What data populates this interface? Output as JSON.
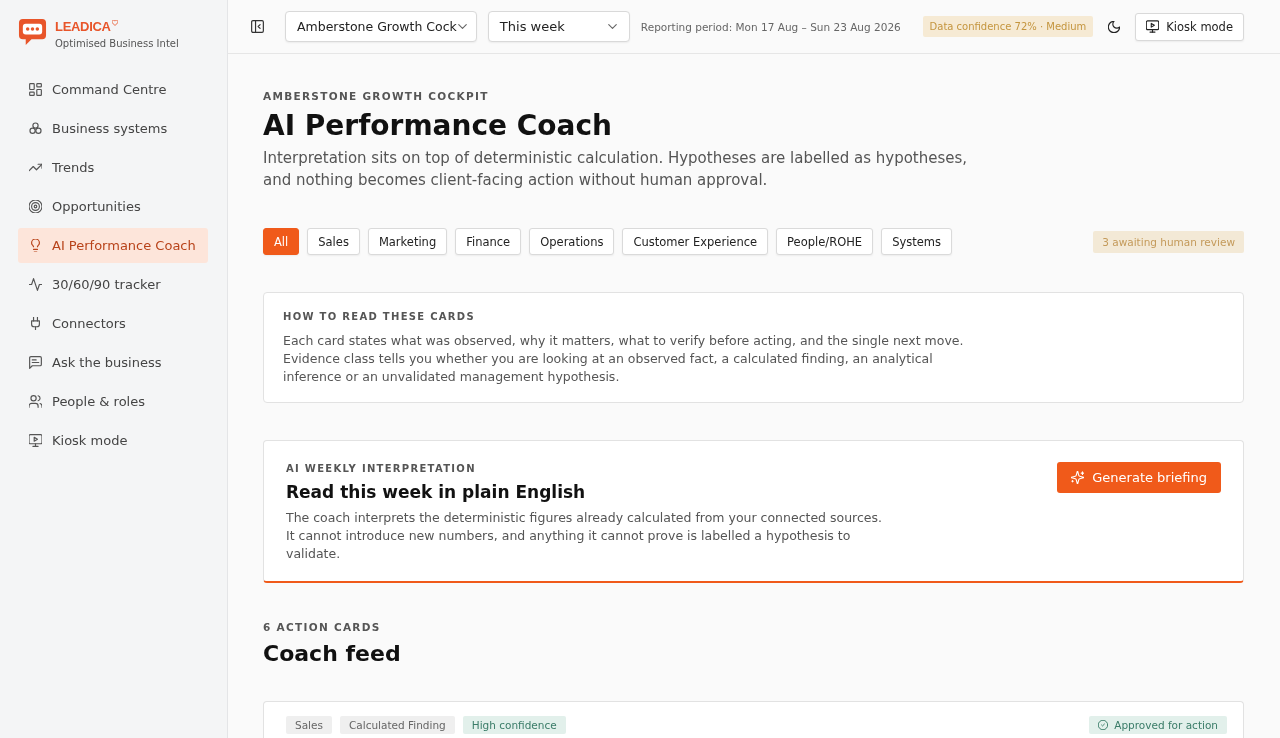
{
  "sidebar": {
    "brand": {
      "name": "LEADICA",
      "tagline": "Optimised Business Intel"
    },
    "items": [
      {
        "label": "Command Centre",
        "selected": false
      },
      {
        "label": "Business systems",
        "selected": false
      },
      {
        "label": "Trends",
        "selected": false
      },
      {
        "label": "Opportunities",
        "selected": false
      },
      {
        "label": "AI Performance Coach",
        "selected": true
      },
      {
        "label": "30/60/90 tracker",
        "selected": false
      },
      {
        "label": "Connectors",
        "selected": false
      },
      {
        "label": "Ask the business",
        "selected": false
      },
      {
        "label": "People & roles",
        "selected": false
      },
      {
        "label": "Kiosk mode",
        "selected": false
      }
    ]
  },
  "topbar": {
    "workspace": {
      "value": "Amberstone Growth Cock"
    },
    "period": {
      "value": "This week"
    },
    "reporting_period": "Reporting period: Mon 17 Aug – Sun 23 Aug 2026",
    "confidence_badge": "Data confidence 72% · Medium",
    "kiosk_button": "Kiosk mode"
  },
  "header": {
    "eyebrow": "AMBERSTONE GROWTH COCKPIT",
    "title": "AI Performance Coach",
    "description": "Interpretation sits on top of deterministic calculation. Hypotheses are labelled as hypotheses, and nothing becomes client-facing action without human approval."
  },
  "filters": {
    "chips": [
      {
        "label": "All",
        "selected": true
      },
      {
        "label": "Sales",
        "selected": false
      },
      {
        "label": "Marketing",
        "selected": false
      },
      {
        "label": "Finance",
        "selected": false
      },
      {
        "label": "Operations",
        "selected": false
      },
      {
        "label": "Customer Experience",
        "selected": false
      },
      {
        "label": "People/ROHE",
        "selected": false
      },
      {
        "label": "Systems",
        "selected": false
      }
    ],
    "review_badge": "3 awaiting human review"
  },
  "guide_card": {
    "eyebrow": "HOW TO READ THESE CARDS",
    "body": "Each card states what was observed, why it matters, what to verify before acting, and the single next move. Evidence class tells you whether you are looking at an observed fact, a calculated finding, an analytical inference or an unvalidated management hypothesis."
  },
  "interpretation_card": {
    "eyebrow": "AI WEEKLY INTERPRETATION",
    "title": "Read this week in plain English",
    "body": "The coach interprets the deterministic figures already calculated from your connected sources. It cannot introduce new numbers, and anything it cannot prove is labelled a hypothesis to validate.",
    "button": "Generate briefing"
  },
  "feed": {
    "eyebrow": "6 ACTION CARDS",
    "title": "Coach feed",
    "cards": [
      {
        "tags": [
          {
            "label": "Sales",
            "kind": "neutral"
          },
          {
            "label": "Calculated Finding",
            "kind": "neutral"
          },
          {
            "label": "High confidence",
            "kind": "positive"
          }
        ],
        "status": {
          "label": "Approved for action",
          "kind": "approved"
        }
      }
    ]
  }
}
